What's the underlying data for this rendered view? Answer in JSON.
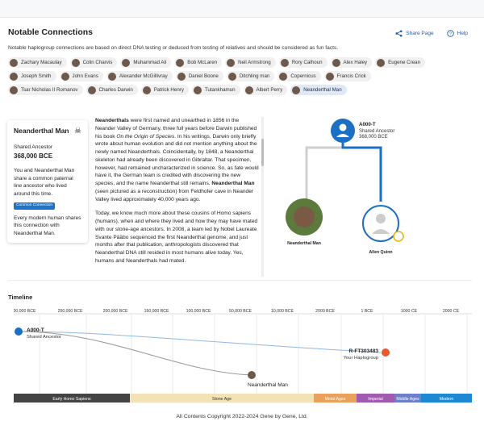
{
  "header": {
    "title": "Notable Connections",
    "share_label": "Share Page",
    "help_label": "Help"
  },
  "description": "Notable haplogroup connections are based on direct DNA testing or deduced from testing of relatives and should be considered as fun facts.",
  "chips": [
    "Zachary Macaulay",
    "Colin Charvis",
    "Muhammad Ali",
    "Bob McLaren",
    "Neil Armstrong",
    "Rory Calhoun",
    "Alex Haley",
    "Eugene Crean",
    "Joseph Smith",
    "John Evans",
    "Alexander McGillivray",
    "Daniel Boone",
    "Ditchling man",
    "Copernicus",
    "Francis Crick",
    "Tsar Nicholas II Romanov",
    "Charles Darwin",
    "Patrick Henry",
    "Tutankhamun",
    "Albert Perry",
    "Neanderthal Man"
  ],
  "card": {
    "name": "Neanderthal Man",
    "ancestor_label": "Shared Ancestor",
    "ancestor_date": "368,000 BCE",
    "text1": "You and Neanderthal Man share a common paternal line ancestor who lived around this time.",
    "badge": "Common Connection",
    "text2": "Every modern human shares this connection with Neanderthal Man."
  },
  "story": {
    "p1_bold": "Neanderthals",
    "p1": " were first named and unearthed in 1856 in the Neander Valley of Germany, three full years before Darwin published his book ",
    "p1_italic": "On the Origin of Species",
    "p1b": ". In his writings, Darwin only briefly wrote about human evolution and did not mention anything about the newly named Neanderthals. Coincidentally, by 1848, a Neanderthal skeleton had already been discovered in Gibraltar. That specimen, however, had remained uncharacterized in science. So, as fate would have it, the German team is credited with discovering the new species, and the name Neanderthal still remains. ",
    "p1_bold2": "Neanderthal Man",
    "p1c": " (seen pictured as a reconstruction) from Feldhofer cave in Neander Valley lived approximately 40,000 years ago.",
    "p2": "Today, we know much more about these cousins of Homo sapiens (humans), when and where they lived and how they may have mated with our stone-age ancestors. In 2008, a team led by Nobel Laureate Svante Pääbo sequenced the first Neanderthal genome, and just months after that publication, anthropologists discovered that Neanderthal DNA still resided in most humans alive today. Yes, humans and Neanderthals had mated."
  },
  "tree": {
    "root_id": "A000-T",
    "root_label": "Shared Ancestor",
    "root_date": "368,000 BCE",
    "left_name": "Neanderthal Man",
    "right_name": "Allen Quinn"
  },
  "timeline": {
    "title": "Timeline",
    "ticks": [
      "300,000 BCE",
      "250,000 BCE",
      "200,000 BCE",
      "150,000 BCE",
      "100,000 BCE",
      "50,000 BCE",
      "10,000 BCE",
      "2000 BCE",
      "1 BCE",
      "1000 CE",
      "2000 CE"
    ],
    "start_id": "A000-T",
    "start_label": "Shared Ancestor",
    "end_id": "R-FT303483",
    "end_label": "Your Haplogroup",
    "mid_label": "Neanderthal Man",
    "eras": [
      {
        "name": "Early Homo Sapiens",
        "color": "#444444"
      },
      {
        "name": "Stone Age",
        "color": "#f2e2b5"
      },
      {
        "name": "Metal Ages",
        "color": "#e9a15b"
      },
      {
        "name": "Imperial",
        "color": "#a05bb0"
      },
      {
        "name": "Middle Ages",
        "color": "#6d7fc8"
      },
      {
        "name": "Modern",
        "color": "#1f88d3"
      }
    ]
  },
  "footer": "All Contents Copyright 2022-2024 Gene by Gene, Ltd."
}
